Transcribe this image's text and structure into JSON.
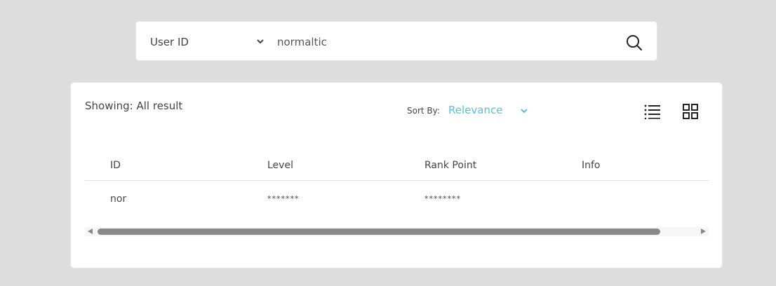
{
  "search": {
    "filter_label": "User ID",
    "query": "normaltic"
  },
  "results": {
    "showing_text": "Showing: All result",
    "sort_label": "Sort By:",
    "sort_value": "Relevance",
    "columns": [
      "ID",
      "Level",
      "Rank Point",
      "Info"
    ],
    "rows": [
      {
        "id": "nor",
        "level": "*******",
        "rank_point": "********",
        "info": ""
      }
    ]
  },
  "colors": {
    "accent": "#5bc0d6",
    "background": "#dddddd"
  }
}
